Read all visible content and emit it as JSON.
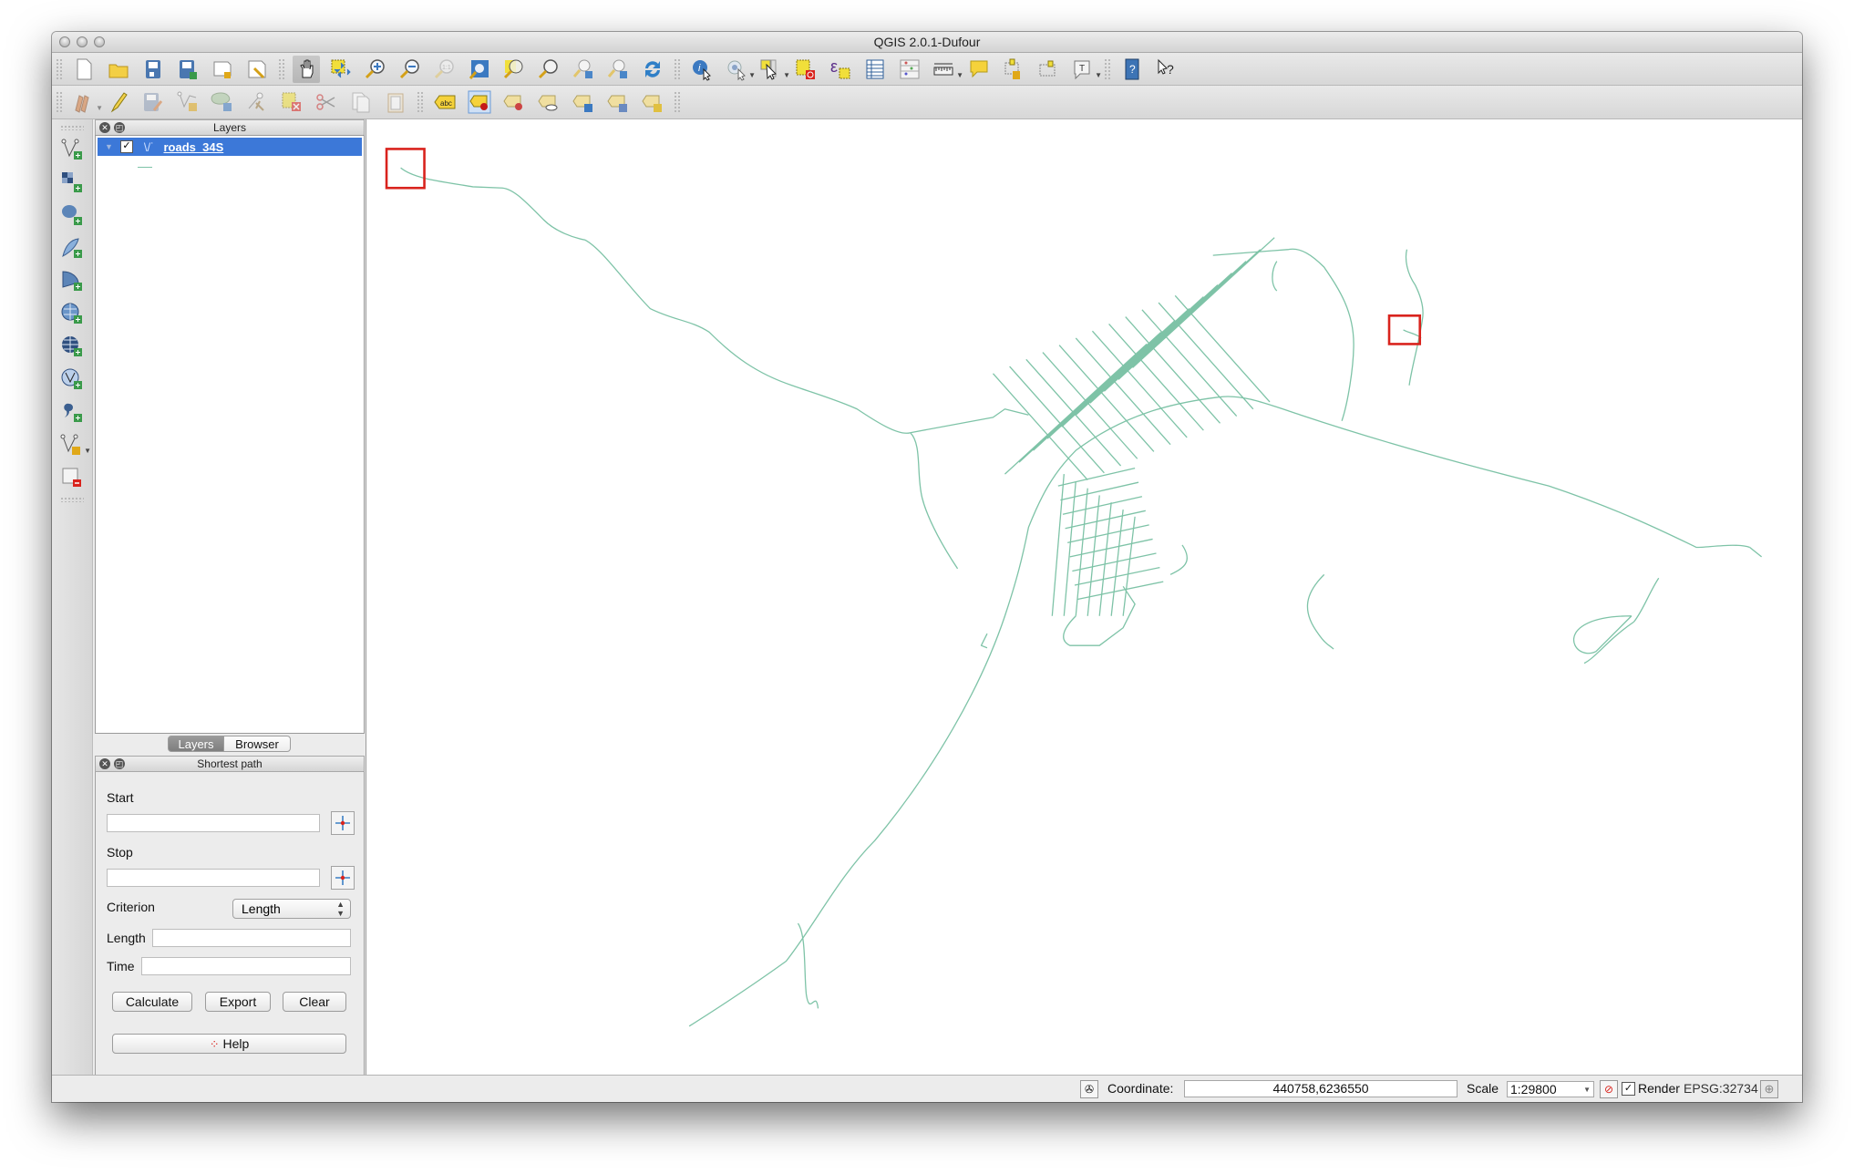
{
  "window": {
    "title": "QGIS 2.0.1-Dufour"
  },
  "toolbar_row1": [
    {
      "name": "new-project-icon",
      "label": "New Project"
    },
    {
      "name": "open-project-icon",
      "label": "Open Project"
    },
    {
      "name": "save-project-icon",
      "label": "Save Project"
    },
    {
      "name": "save-project-as-icon",
      "label": "Save Project As"
    },
    {
      "name": "new-print-composer-icon",
      "label": "New Print Composer"
    },
    {
      "name": "composer-manager-icon",
      "label": "Composer Manager"
    },
    {
      "name": "pan-map-icon",
      "label": "Pan Map",
      "active": true
    },
    {
      "name": "pan-to-selection-icon",
      "label": "Pan Map to Selection"
    },
    {
      "name": "zoom-in-icon",
      "label": "Zoom In"
    },
    {
      "name": "zoom-out-icon",
      "label": "Zoom Out"
    },
    {
      "name": "zoom-actual-size-icon",
      "label": "Zoom to Native Resolution"
    },
    {
      "name": "zoom-full-icon",
      "label": "Zoom Full"
    },
    {
      "name": "zoom-to-selection-icon",
      "label": "Zoom to Selection"
    },
    {
      "name": "zoom-to-layer-icon",
      "label": "Zoom to Layer"
    },
    {
      "name": "zoom-last-icon",
      "label": "Zoom Last"
    },
    {
      "name": "zoom-next-icon",
      "label": "Zoom Next"
    },
    {
      "name": "refresh-icon",
      "label": "Refresh"
    },
    {
      "name": "identify-icon",
      "label": "Identify Features"
    },
    {
      "name": "run-action-icon",
      "label": "Run Feature Action"
    },
    {
      "name": "select-features-icon",
      "label": "Select Features"
    },
    {
      "name": "deselect-all-icon",
      "label": "Deselect All"
    },
    {
      "name": "expression-select-icon",
      "label": "Select by Expression"
    },
    {
      "name": "attribute-table-icon",
      "label": "Open Attribute Table"
    },
    {
      "name": "field-calculator-icon",
      "label": "Open Field Calculator"
    },
    {
      "name": "measure-line-icon",
      "label": "Measure Line"
    },
    {
      "name": "map-tips-icon",
      "label": "Map Tips"
    },
    {
      "name": "new-bookmark-icon",
      "label": "New Bookmark"
    },
    {
      "name": "show-bookmarks-icon",
      "label": "Show Bookmarks"
    },
    {
      "name": "text-annotation-icon",
      "label": "Text Annotation"
    },
    {
      "name": "help-contents-icon",
      "label": "Help Contents"
    },
    {
      "name": "whats-this-icon",
      "label": "What's This?"
    }
  ],
  "toolbar_row2": [
    {
      "name": "current-edits-icon",
      "label": "Current Edits"
    },
    {
      "name": "toggle-editing-icon",
      "label": "Toggle Editing"
    },
    {
      "name": "save-layer-edits-icon",
      "label": "Save Layer Edits"
    },
    {
      "name": "add-feature-icon",
      "label": "Add Feature"
    },
    {
      "name": "move-feature-icon",
      "label": "Move Feature"
    },
    {
      "name": "node-tool-icon",
      "label": "Node Tool"
    },
    {
      "name": "delete-selected-icon",
      "label": "Delete Selected"
    },
    {
      "name": "cut-features-icon",
      "label": "Cut Features"
    },
    {
      "name": "copy-features-icon",
      "label": "Copy Features"
    },
    {
      "name": "paste-features-icon",
      "label": "Paste Features"
    },
    {
      "name": "layer-labeling-icon",
      "label": "Layer Labeling Options"
    },
    {
      "name": "highlight-pinned-labels-icon",
      "label": "Highlight Pinned Labels"
    },
    {
      "name": "pin-labels-icon",
      "label": "Pin/Unpin Labels"
    },
    {
      "name": "show-hide-labels-icon",
      "label": "Show/Hide Labels"
    },
    {
      "name": "move-label-icon",
      "label": "Move Label"
    },
    {
      "name": "rotate-label-icon",
      "label": "Rotate Label"
    },
    {
      "name": "change-label-icon",
      "label": "Change Label"
    }
  ],
  "left_toolbar": [
    {
      "name": "add-vector-layer-icon",
      "label": "Add Vector Layer"
    },
    {
      "name": "add-raster-layer-icon",
      "label": "Add Raster Layer"
    },
    {
      "name": "add-postgis-layer-icon",
      "label": "Add PostGIS Layer"
    },
    {
      "name": "add-spatialite-layer-icon",
      "label": "Add SpatiaLite Layer"
    },
    {
      "name": "add-mssql-layer-icon",
      "label": "Add MSSQL Spatial Layer"
    },
    {
      "name": "add-wms-layer-icon",
      "label": "Add WMS/WMTS Layer"
    },
    {
      "name": "add-wcs-layer-icon",
      "label": "Add WCS Layer"
    },
    {
      "name": "add-wfs-layer-icon",
      "label": "Add WFS Layer"
    },
    {
      "name": "add-delimited-text-layer-icon",
      "label": "Add Delimited Text Layer"
    },
    {
      "name": "new-shapefile-layer-icon",
      "label": "New Shapefile Layer"
    },
    {
      "name": "remove-layer-icon",
      "label": "Remove Layer"
    }
  ],
  "layers_panel": {
    "title": "Layers",
    "layers": [
      {
        "name": "roads_34S",
        "checked": true,
        "type": "line",
        "color": "#7ec3a7",
        "selected": true
      }
    ]
  },
  "dock_tabs": [
    {
      "label": "Layers",
      "active": true
    },
    {
      "label": "Browser",
      "active": false
    }
  ],
  "shortest_path": {
    "title": "Shortest path",
    "start_label": "Start",
    "start_value": "",
    "stop_label": "Stop",
    "stop_value": "",
    "criterion_label": "Criterion",
    "criterion_value": "Length",
    "length_label": "Length",
    "length_value": "",
    "time_label": "Time",
    "time_value": "",
    "calculate_label": "Calculate",
    "export_label": "Export",
    "clear_label": "Clear",
    "help_label": "Help"
  },
  "map": {
    "layer": "roads_34S",
    "road_color": "#7ec3a7",
    "highlight_color": "#d9231d"
  },
  "status_bar": {
    "coordinate_label": "Coordinate:",
    "coordinate_value": "440758,6236550",
    "scale_label": "Scale",
    "scale_value": "1:29800",
    "render_label": "Render",
    "render_checked": true,
    "crs": "EPSG:32734"
  }
}
